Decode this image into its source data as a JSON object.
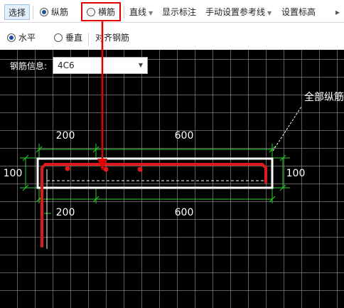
{
  "toolbar": {
    "select_label": "选择",
    "longitudinal_label": "纵筋",
    "transverse_label": "横筋",
    "straight_label": "直线",
    "show_dims_label": "显示标注",
    "manual_ref_label": "手动设置参考线",
    "set_elevation_label": "设置标高"
  },
  "toolbar2": {
    "horizontal_label": "水平",
    "vertical_label": "垂直",
    "align_label": "对齐钢筋"
  },
  "canvas": {
    "rebar_info_label": "钢筋信息:",
    "rebar_value": "4C6",
    "callout_text": "全部纵筋",
    "dim_top_left": "200",
    "dim_top_right": "600",
    "dim_left": "100",
    "dim_right": "100",
    "dim_bottom_left": "200",
    "dim_bottom_right": "600"
  },
  "colors": {
    "highlight": "#e20000",
    "rebar": "#e01a1a",
    "dimension": "#2bd12b",
    "canvas_bg": "#000000"
  }
}
